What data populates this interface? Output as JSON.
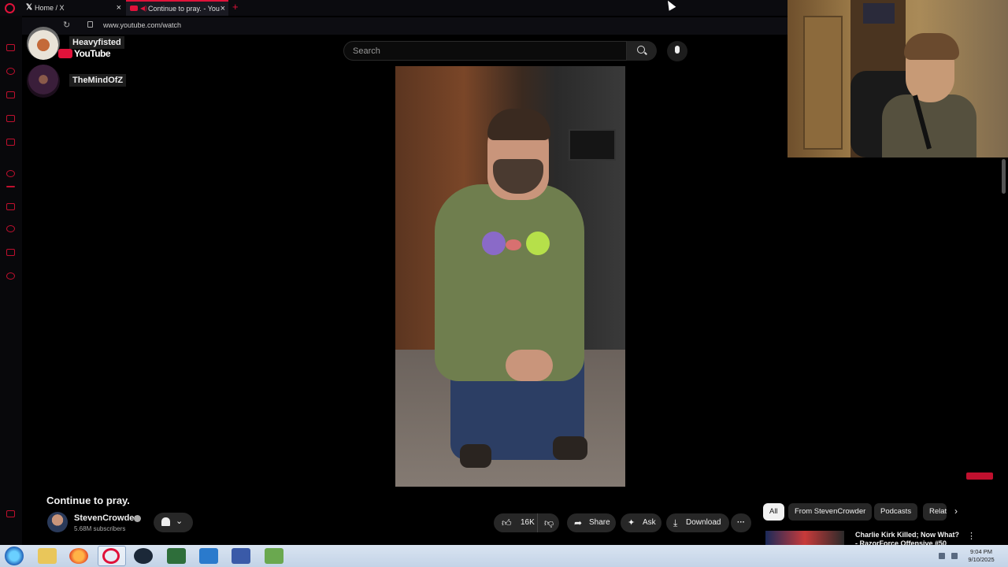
{
  "browser": {
    "tabs": [
      {
        "label": "Home / X"
      },
      {
        "label": "Continue to pray. - You"
      }
    ],
    "url": "www.youtube.com/watch",
    "accent_color": "#e0123a"
  },
  "sidebar": {
    "icons": [
      "opera-logo-icon",
      "gamepad-icon",
      "aria-icon",
      "bag-icon",
      "twitch-icon",
      "instagram-icon",
      "whatsapp-icon",
      "music-icon",
      "pencil-icon",
      "history-icon",
      "cube-icon",
      "settings-icon",
      "more-icon"
    ]
  },
  "youtube": {
    "logo_text": "YouTube",
    "search_placeholder": "Search"
  },
  "chat": [
    {
      "name": "Heavyfisted"
    },
    {
      "name": "TheMindOfZ"
    }
  ],
  "video": {
    "title": "Continue to pray.",
    "channel": "StevenCrowder",
    "subscribers": "5.68M subscribers",
    "likes": "16K",
    "share_label": "Share",
    "ask_label": "Ask",
    "download_label": "Download",
    "more_label": "···"
  },
  "filters": [
    "All",
    "From StevenCrowder",
    "Podcasts",
    "Relat"
  ],
  "recommendation": {
    "title": "Charlie Kirk Killed; Now What? - RazorForce Offensive #50"
  },
  "taskbar": {
    "time": "9:04 PM",
    "date": "9/10/2025"
  }
}
